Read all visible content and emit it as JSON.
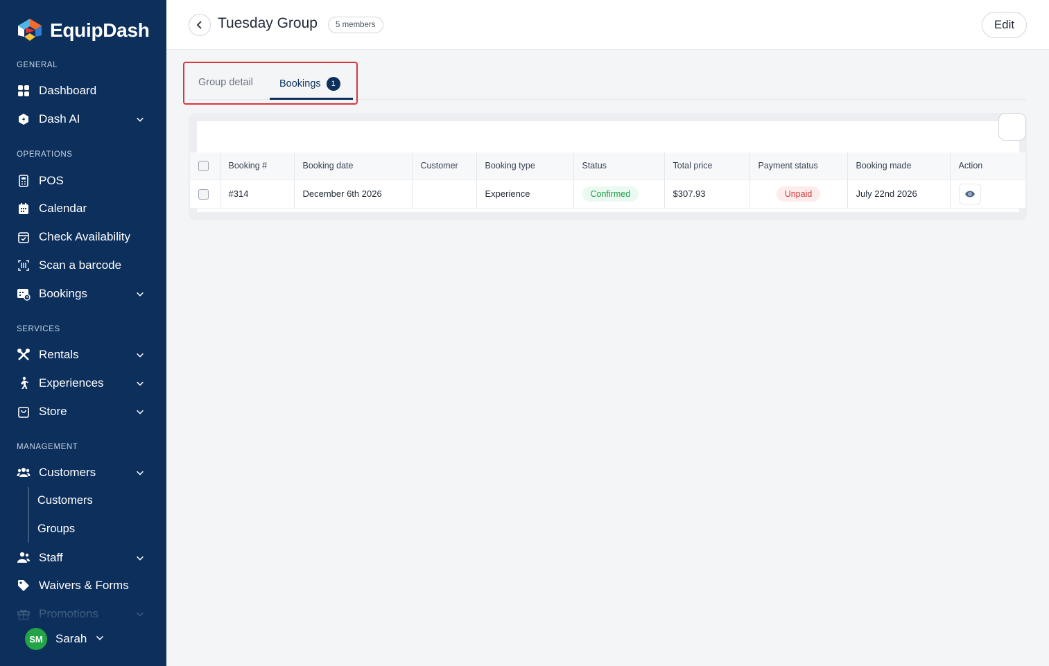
{
  "brand": {
    "name": "EquipDash"
  },
  "sidebar": {
    "sections": {
      "general": "GENERAL",
      "operations": "OPERATIONS",
      "services": "SERVICES",
      "management": "MANAGEMENT"
    },
    "items": {
      "dashboard": "Dashboard",
      "dash_ai": "Dash AI",
      "pos": "POS",
      "calendar": "Calendar",
      "check_availability": "Check Availability",
      "scan_barcode": "Scan a barcode",
      "bookings": "Bookings",
      "rentals": "Rentals",
      "experiences": "Experiences",
      "store": "Store",
      "customers": "Customers",
      "customers_sub": "Customers",
      "groups_sub": "Groups",
      "staff": "Staff",
      "waivers": "Waivers & Forms",
      "promotions": "Promotions"
    },
    "user": {
      "initials": "SM",
      "name": "Sarah"
    }
  },
  "header": {
    "title": "Tuesday Group",
    "members_badge": "5 members",
    "edit_label": "Edit"
  },
  "tabs": {
    "group_detail": "Group detail",
    "bookings": "Bookings",
    "bookings_count": "1"
  },
  "table": {
    "columns": [
      "Booking #",
      "Booking date",
      "Customer",
      "Booking type",
      "Status",
      "Total price",
      "Payment status",
      "Booking made",
      "Action"
    ],
    "rows": [
      {
        "booking_no": "#314",
        "booking_date": "December 6th 2026",
        "customer": "",
        "booking_type": "Experience",
        "status": "Confirmed",
        "total_price": "$307.93",
        "payment_status": "Unpaid",
        "booking_made": "July 22nd 2026"
      }
    ]
  },
  "colors": {
    "sidebar_bg": "#0c2f5c",
    "accent": "#0c2f5c",
    "confirmed": "#1f9d4a",
    "unpaid": "#d63b3b",
    "highlight": "#d9363e"
  }
}
